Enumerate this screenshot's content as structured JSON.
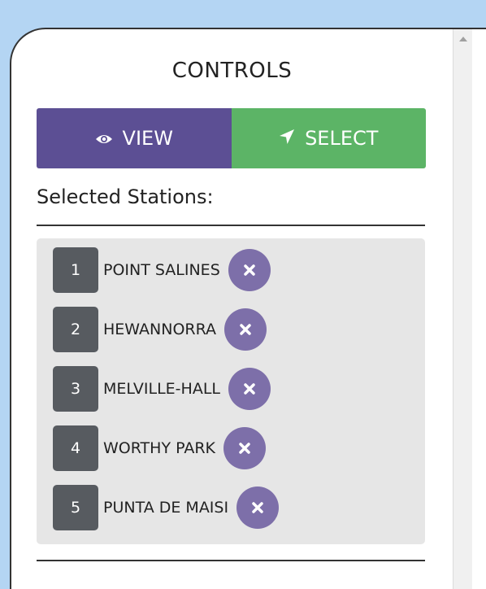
{
  "panel": {
    "title": "CONTROLS"
  },
  "mode_toggle": {
    "view_label": "VIEW",
    "select_label": "SELECT",
    "view_icon": "eye-icon",
    "select_icon": "location-arrow-icon"
  },
  "selected_stations": {
    "label": "Selected Stations:",
    "items": [
      {
        "number": "1",
        "name": "POINT SALINES"
      },
      {
        "number": "2",
        "name": "HEWANNORRA"
      },
      {
        "number": "3",
        "name": "MELVILLE-HALL"
      },
      {
        "number": "4",
        "name": "WORTHY PARK"
      },
      {
        "number": "5",
        "name": "PUNTA DE MAISI"
      }
    ]
  },
  "colors": {
    "view_button": "#5c4f94",
    "select_button": "#5cb466",
    "remove_button": "#7d6fa9",
    "number_badge": "#575b60",
    "list_background": "#e6e6e6",
    "page_background": "#b4d5f3"
  }
}
